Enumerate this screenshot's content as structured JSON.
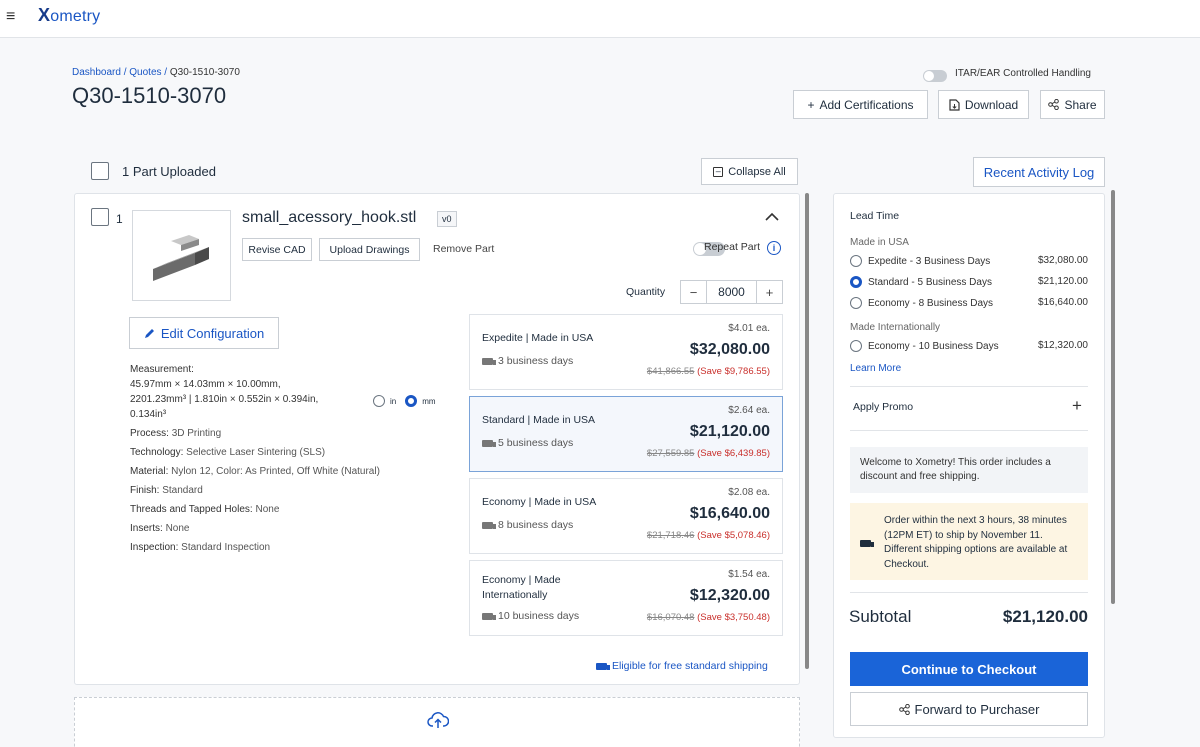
{
  "topbar": {
    "menu_icon": "hamburger-icon",
    "logo_text": "ometry",
    "logo_mark": "X"
  },
  "breadcrumb": {
    "dashboard": "Dashboard",
    "sep1": "/",
    "quotes": "Quotes",
    "sep2": "/",
    "current": "Q30-1510-3070"
  },
  "quote": {
    "title": "Q30-1510-3070",
    "itar_label": "ITAR/EAR Controlled Handling",
    "add_certifications": "Add Certifications",
    "download": "Download",
    "share": "Share"
  },
  "parts_header": {
    "label": "1 Part Uploaded",
    "collapse_all": "Collapse All",
    "recent_activity": "Recent Activity Log"
  },
  "part": {
    "index": "1",
    "filename": "small_acessory_hook.stl",
    "version": "v0",
    "revise_cad": "Revise CAD",
    "upload_drawings": "Upload Drawings",
    "remove_part": "Remove Part",
    "repeat_part": "Repeat Part",
    "quantity_label": "Quantity",
    "quantity": "8000",
    "edit_configuration": "Edit Configuration",
    "measurement_label": "Measurement:",
    "measurement_line1": "45.97mm × 14.03mm × 10.00mm,",
    "measurement_line2": "2201.23mm³  |  1.810in × 0.552in × 0.394in,",
    "measurement_line3": "0.134in³",
    "unit_in": "in",
    "unit_mm": "mm",
    "specs": [
      {
        "k": "Process:",
        "v": "3D Printing"
      },
      {
        "k": "Technology:",
        "v": "Selective Laser Sintering (SLS)"
      },
      {
        "k": "Material:",
        "v": "Nylon 12, Color: As Printed, Off White (Natural)"
      },
      {
        "k": "Finish:",
        "v": "Standard"
      },
      {
        "k": "Threads and Tapped Holes:",
        "v": "None"
      },
      {
        "k": "Inserts:",
        "v": "None"
      },
      {
        "k": "Inspection:",
        "v": "Standard Inspection"
      }
    ],
    "free_shipping": "Eligible for free standard shipping"
  },
  "price_options": [
    {
      "name": "Expedite | Made in USA",
      "days": "3 business days",
      "each": "$4.01 ea.",
      "total": "$32,080.00",
      "was": "$41,866.55",
      "save": "(Save $9,786.55)"
    },
    {
      "name": "Standard | Made in USA",
      "days": "5 business days",
      "each": "$2.64 ea.",
      "total": "$21,120.00",
      "was": "$27,559.85",
      "save": "(Save $6,439.85)"
    },
    {
      "name": "Economy | Made in USA",
      "days": "8 business days",
      "each": "$2.08 ea.",
      "total": "$16,640.00",
      "was": "$21,718.46",
      "save": "(Save $5,078.46)"
    },
    {
      "name": "Economy | Made Internationally",
      "days": "10 business days",
      "each": "$1.54 ea.",
      "total": "$12,320.00",
      "was": "$16,070.48",
      "save": "(Save $3,750.48)"
    }
  ],
  "sidebar": {
    "lead_time": "Lead Time",
    "made_usa": "Made in USA",
    "made_intl": "Made Internationally",
    "options": [
      {
        "label": "Expedite - 3 Business Days",
        "price": "$32,080.00"
      },
      {
        "label": "Standard - 5 Business Days",
        "price": "$21,120.00"
      },
      {
        "label": "Economy - 8 Business Days",
        "price": "$16,640.00"
      },
      {
        "label": "Economy - 10 Business Days",
        "price": "$12,320.00"
      }
    ],
    "learn_more": "Learn More",
    "apply_promo": "Apply Promo",
    "welcome": "Welcome to Xometry! This order includes a discount and free shipping.",
    "notice": "Order within the next 3 hours, 38 minutes (12PM ET) to ship by November 11. Different shipping options are available at Checkout.",
    "subtotal_label": "Subtotal",
    "subtotal": "$21,120.00",
    "continue_checkout": "Continue to Checkout",
    "forward_purchaser": "Forward to Purchaser"
  },
  "colors": {
    "accent": "#1a64d8",
    "link": "#1a56c4",
    "save": "#c9302c",
    "notice_bg": "#fdf5e3"
  }
}
